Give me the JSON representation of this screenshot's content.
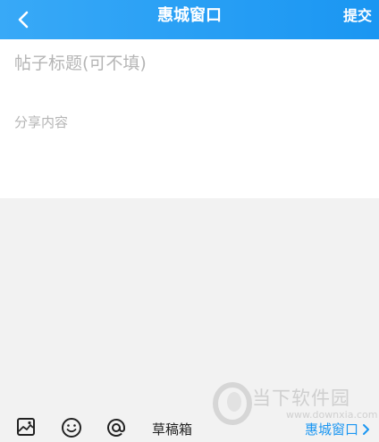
{
  "header": {
    "back_icon": "chevron-left-icon",
    "title": "惠城窗口",
    "submit_label": "提交"
  },
  "editor": {
    "title_placeholder": "帖子标题(可不填)",
    "content_placeholder": "分享内容"
  },
  "toolbar": {
    "icons": [
      "image-icon",
      "emoji-icon",
      "at-icon"
    ],
    "drafts_label": "草稿箱",
    "forum_label": "惠城窗口"
  },
  "watermark": {
    "text": "当下软件园",
    "url": "www.downxia.com"
  },
  "colors": {
    "header_start": "#38a9f7",
    "header_end": "#1a96f2",
    "accent": "#1a96f2",
    "background": "#f2f2f2"
  }
}
